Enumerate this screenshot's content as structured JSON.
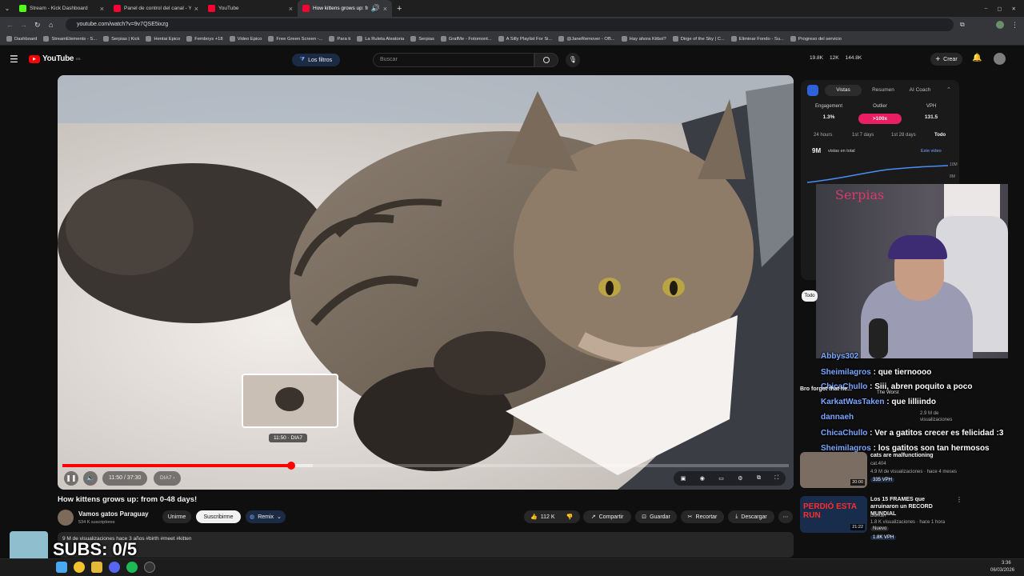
{
  "browser": {
    "tabs": [
      {
        "title": "Stream - Kick Dashboard",
        "color": "#53fc18"
      },
      {
        "title": "Panel de control del canal - Yo",
        "color": "#ff0033"
      },
      {
        "title": "YouTube",
        "color": "#ff0033"
      },
      {
        "title": "How kittens grows up: from",
        "color": "#ff0033"
      }
    ],
    "url": "youtube.com/watch?v=9v7QSE5ixzg",
    "bookmarks": [
      "Dashboard",
      "StreamElements - S...",
      "Serpias | Kick",
      "Hentai Epico",
      "Femboys +18",
      "Video Epico",
      "Free Green Screen -...",
      "Para ti",
      "La Ruleta Aleatoria",
      "Serpias",
      "GrafMe - Fotomont...",
      "A Silly Playlist For Si...",
      "@JaneRemover - OB...",
      "Hay ahora Kitbol?",
      "Dirge of the Sky | C...",
      "Eliminar Fondo - Su...",
      "Progreso del servicio"
    ]
  },
  "youtube": {
    "logo": "YouTube",
    "logo_sup": "ES",
    "filters_label": "Los filtros",
    "search_placeholder": "Buscar",
    "stats": [
      "19.8K",
      "12K",
      "144.8K"
    ],
    "create_label": "Crear"
  },
  "player": {
    "time": "11:50 / 37:30",
    "chapter": "DIA7",
    "preview_time": "11:50 · DIA7",
    "progress": 0.315,
    "buffered": 0.345
  },
  "video": {
    "title": "How kittens grows up: from 0-48 days!",
    "channel": "Vamos gatos Paraguay",
    "subscribers": "534 K suscriptores",
    "join_label": "Unirme",
    "subscribe_label": "Suscribirme",
    "remix_label": "Remix",
    "likes": "112 K",
    "share_label": "Compartir",
    "save_label": "Guardar",
    "clip_label": "Recortar",
    "download_label": "Descargar",
    "meta": "9 M de visualizaciones  hace 3 años  #birth #meet #kitten"
  },
  "analytics": {
    "tabs": [
      "Vistas",
      "Resumen",
      "AI Coach"
    ],
    "headers": [
      "Engagement",
      "Outlier",
      "VPH"
    ],
    "values": [
      "1.3%",
      ">100x",
      "131.5"
    ],
    "ranges": [
      "24 hours",
      "1st 7 days",
      "1st 28 days",
      "Todo"
    ],
    "total": "9M",
    "total_label": "vistas en total",
    "legend": "Este video",
    "axis": [
      "10M",
      "8M"
    ]
  },
  "overlay": {
    "subs_label": "SUBS: 0/5",
    "cam_sign": "Serpias"
  },
  "chat": [
    {
      "user": "Abbys302",
      "msg": ""
    },
    {
      "user": "Sheimilagros",
      "msg": "que tiernoooo"
    },
    {
      "user": "ChicaChullo",
      "msg": "Siii, abren poquito a poco"
    },
    {
      "user": "KarkatWasTaken",
      "msg": "que lilliindo"
    },
    {
      "user": "dannaeh",
      "msg": ""
    },
    {
      "user": "ChicaChullo",
      "msg": "Ver a gatitos crecer es felicidad :3"
    },
    {
      "user": "Sheimilagros",
      "msg": "los gatitos son tan hermosos"
    }
  ],
  "recommendations": [
    {
      "title": "Bro forgot that he...",
      "meta1": "2.9 M de",
      "meta2": "visualizaciones",
      "duration": "",
      "tag": "The Worst"
    },
    {
      "title": "cats are malfunctioning",
      "meta1": "cat.404",
      "meta2": "4.9 M de visualizaciones · hace 4 meses",
      "meta3": "335 VPH",
      "duration": "20:00",
      "tag": ""
    },
    {
      "title": "Los 15 FRAMES que arruinaron un RECORD MUNDIAL",
      "meta1": "Darkan",
      "meta2": "1.8 K visualizaciones · hace 1 hora",
      "meta3": "Nuevo",
      "meta4": "1.8K VPH",
      "duration": "21:22",
      "tag": "PERDIÓ ESTA RUN"
    }
  ],
  "system": {
    "time": "3:36",
    "date": "06/03/2026"
  },
  "colors": {
    "accent": "#ff0000",
    "panel_pill": "#e91e63",
    "chat_user": "#7aa7ff"
  }
}
